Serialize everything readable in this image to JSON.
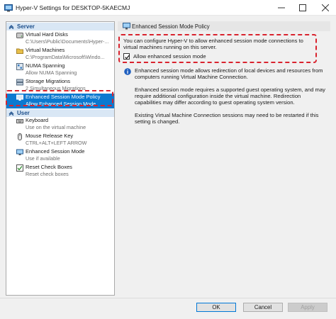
{
  "window": {
    "title": "Hyper-V Settings for DESKTOP-5KAECMJ"
  },
  "tree": {
    "server_header": "Server",
    "user_header": "User",
    "server_items": [
      {
        "label": "Virtual Hard Disks",
        "value": "C:\\Users\\Public\\Documents\\Hyper-...",
        "icon": "disk-icon"
      },
      {
        "label": "Virtual Machines",
        "value": "C:\\ProgramData\\Microsoft\\Windo...",
        "icon": "folder-icon"
      },
      {
        "label": "NUMA Spanning",
        "value": "Allow NUMA Spanning",
        "icon": "numa-icon"
      },
      {
        "label": "Storage Migrations",
        "value": "2 Simultaneous Migrations",
        "icon": "storage-icon"
      },
      {
        "label": "Enhanced Session Mode Policy",
        "value": "Allow Enhanced Session Mode",
        "icon": "session-policy-icon"
      }
    ],
    "user_items": [
      {
        "label": "Keyboard",
        "value": "Use on the virtual machine",
        "icon": "keyboard-icon"
      },
      {
        "label": "Mouse Release Key",
        "value": "CTRL+ALT+LEFT ARROW",
        "icon": "mouse-icon"
      },
      {
        "label": "Enhanced Session Mode",
        "value": "Use if available",
        "icon": "session-icon"
      },
      {
        "label": "Reset Check Boxes",
        "value": "Reset check boxes",
        "icon": "reset-checkbox-icon"
      }
    ]
  },
  "panel": {
    "header": "Enhanced Session Mode Policy",
    "description": "You can configure Hyper-V to allow enhanced session mode connections to virtual machines running on this server.",
    "checkbox_label": "Allow enhanced session mode",
    "checkbox_checked": true,
    "info_paragraphs": [
      "Enhanced session mode allows redirection of local devices and resources from computers running Virtual Machine Connection.",
      "Enhanced session mode requires a supported guest operating system, and may require additional configuration inside the virtual machine. Redirection capabilities may differ according to guest operating system version.",
      "Existing Virtual Machine Connection sessions may need to be restarted if this setting is changed."
    ]
  },
  "buttons": {
    "ok": "OK",
    "cancel": "Cancel",
    "apply": "Apply"
  },
  "colors": {
    "selection": "#0b79d0",
    "highlight_outline": "#d9232e",
    "section_header": "#d9e7f5"
  }
}
